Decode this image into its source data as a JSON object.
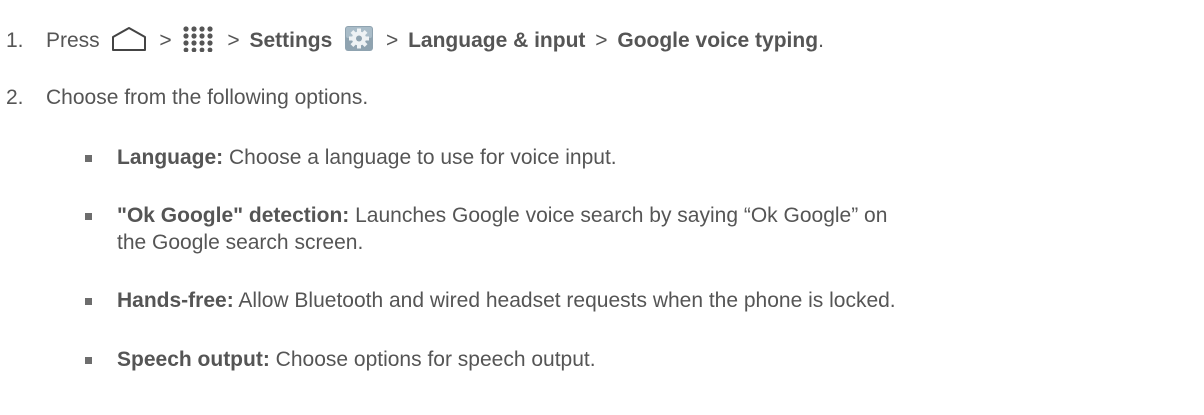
{
  "steps": [
    {
      "number": "1.",
      "press": "Press",
      "sep": ">",
      "settings": "Settings",
      "language_input": "Language & input",
      "voice_typing": "Google voice typing",
      "period": ".",
      "icons": [
        "home-icon",
        "apps-icon",
        "settings-icon"
      ]
    },
    {
      "number": "2.",
      "text": "Choose from the following options."
    }
  ],
  "options": [
    {
      "label": "Language:",
      "desc": "Choose a language to use for voice input."
    },
    {
      "label": "\"Ok Google\" detection:",
      "desc_line1": "Launches Google voice search by saying “Ok Google” on",
      "desc_line2": "the Google search screen."
    },
    {
      "label": "Hands-free:",
      "desc": "Allow Bluetooth and wired headset requests when the phone is locked."
    },
    {
      "label": "Speech output:",
      "desc": "Choose options for speech output."
    }
  ],
  "colors": {
    "text": "#555555",
    "bullet": "#6d6d6d",
    "settings_icon_bg": "#8fa3b0"
  }
}
